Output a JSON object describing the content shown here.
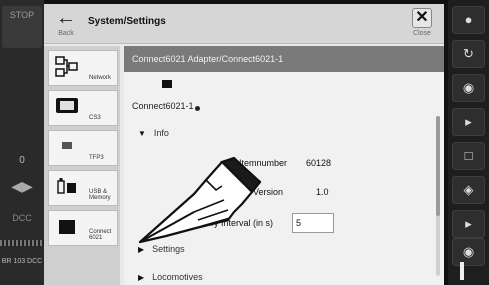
{
  "status_panel": {
    "stop_label": "STOP",
    "dcc_label": "DCC",
    "loco_label": "BR 103 DCC"
  },
  "dialog": {
    "title": "System/Settings",
    "back_label": "Back",
    "close_label": "Close",
    "close_symbol": "✕"
  },
  "categories": [
    {
      "icon": "network-icon",
      "label": "Network",
      "selected": false
    },
    {
      "icon": "cs3-icon",
      "label": "CS3",
      "selected": false
    },
    {
      "icon": "tfp3-icon",
      "label": "TFP3",
      "selected": false
    },
    {
      "icon": "usb-memory-icon",
      "label": "USB & Memory",
      "selected": false
    },
    {
      "icon": "connect6021-icon",
      "label": "Connect 6021",
      "selected": true
    }
  ],
  "content": {
    "heading": "Connect6021 Adapter/Connect6021-1",
    "device_name": "Connect6021-1",
    "sections": {
      "info": "Info",
      "settings": "Settings",
      "locomotives": "Locomotives"
    },
    "fields": {
      "item_number_label": "Itemnumber",
      "item_number_value": "60128",
      "version_label": "Version",
      "version_value": "1.0",
      "interval_label": "Query Interval (in s)",
      "interval_value": "5"
    }
  },
  "function_buttons": [
    {
      "icon": "light-icon"
    },
    {
      "icon": "whistle-icon"
    },
    {
      "icon": "sound-icon"
    },
    {
      "icon": "horn-icon"
    },
    {
      "icon": "coupler-icon"
    },
    {
      "icon": "smoke-icon"
    },
    {
      "icon": "bell-icon"
    },
    {
      "icon": "sound-2-icon"
    }
  ],
  "colors": {
    "header_bg": "#d6d6d6",
    "title_bar_bg": "#7a7a7a",
    "strip_bg": "#1e1e1e"
  }
}
